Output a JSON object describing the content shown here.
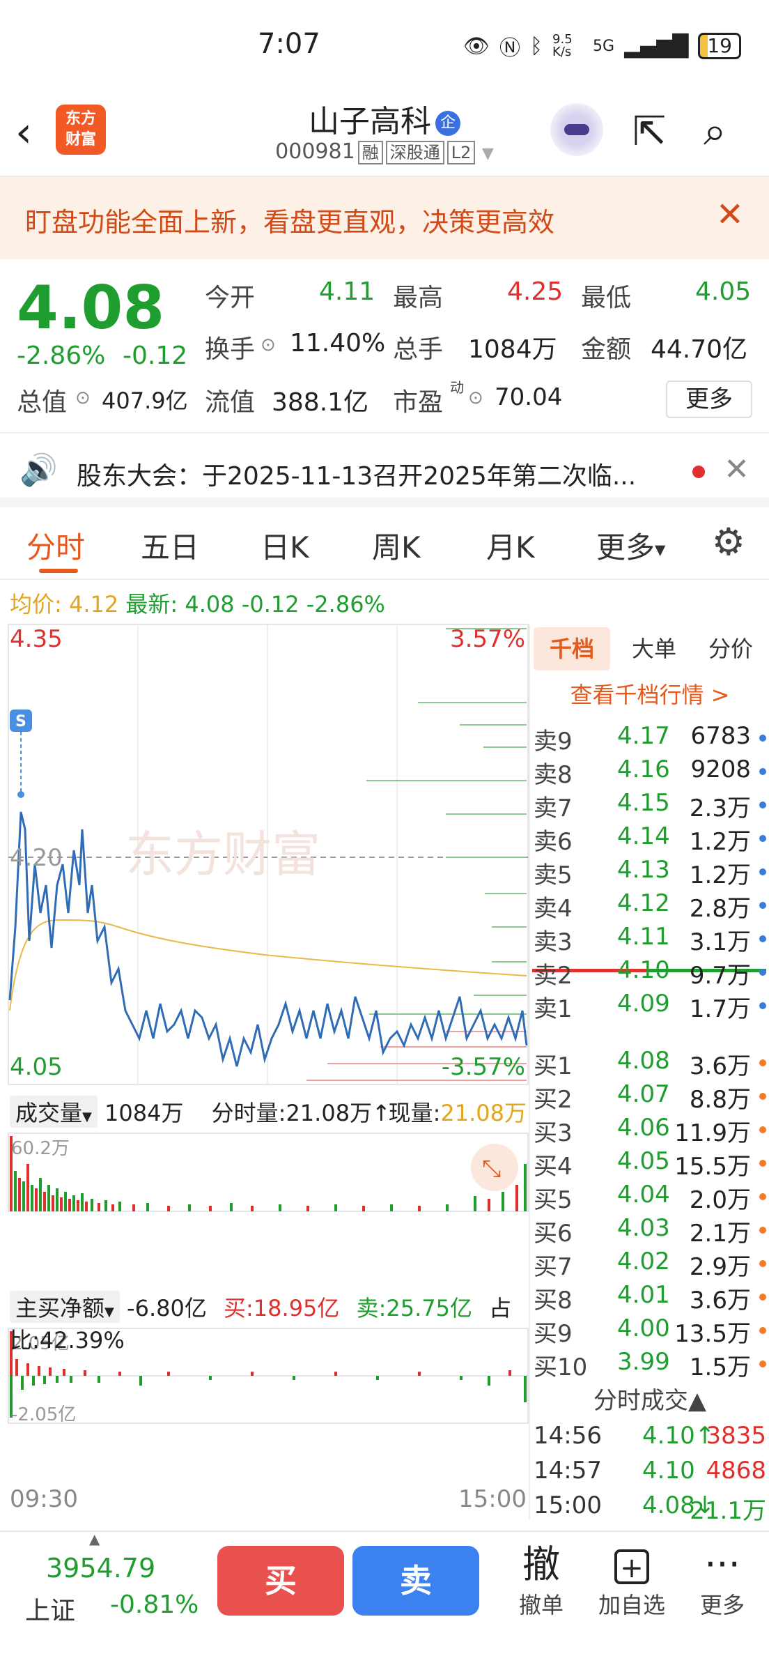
{
  "status_bar": {
    "time": "7:07",
    "net_speed": "9.5 K/s",
    "network": "5G",
    "battery": "19"
  },
  "header": {
    "logo_text": "东方财富",
    "title": "山子高科",
    "badge": "企",
    "code": "000981",
    "tags": [
      "融",
      "深股通",
      "L2"
    ]
  },
  "banner": {
    "text": "盯盘功能全面上新，看盘更直观，决策更高效"
  },
  "quote": {
    "price": "4.08",
    "change_pct": "-2.86%",
    "change": "-0.12",
    "open_label": "今开",
    "open": "4.11",
    "high_label": "最高",
    "high": "4.25",
    "low_label": "最低",
    "low": "4.05",
    "turnover_label": "换手",
    "turnover": "11.40%",
    "volume_label": "总手",
    "volume": "1084万",
    "amount_label": "金额",
    "amount": "44.70亿",
    "mktcap_label": "总值",
    "mktcap": "407.9亿",
    "float_label": "流值",
    "float": "388.1亿",
    "pe_label": "市盈",
    "pe_sup": "动",
    "pe": "70.04",
    "more": "更多"
  },
  "notice": {
    "text": "股东大会：于2025-11-13召开2025年第二次临..."
  },
  "tabs": [
    "分时",
    "五日",
    "日K",
    "周K",
    "月K",
    "更多"
  ],
  "avg_line": {
    "avg_label": "均价:",
    "avg": "4.12",
    "last_label": "最新:",
    "last": "4.08",
    "chg": "-0.12",
    "pct": "-2.86%"
  },
  "chart": {
    "price_high": "4.35",
    "price_mid": "4.20",
    "price_low": "4.05",
    "pct_high": "3.57%",
    "pct_low": "-3.57%",
    "watermark": "东方财富",
    "time_start": "09:30",
    "time_end": "15:00",
    "marker": "S"
  },
  "volume": {
    "selector": "成交量",
    "total": "1084万",
    "tick_vol": "分时量:21.08万↑",
    "now_label": "现量:",
    "now": "21.08万",
    "max": "60.2万"
  },
  "net_flow": {
    "selector": "主买净额",
    "net": "-6.80亿",
    "buy": "买:18.95亿",
    "sell": "卖:25.75亿",
    "ratio": "占比:42.39%",
    "top": "2.05亿",
    "bottom": "-2.05亿"
  },
  "right_panel": {
    "tabs": [
      "千档",
      "大单",
      "分价"
    ],
    "link": "查看千档行情 >",
    "asks": [
      {
        "label": "卖9",
        "price": "4.17",
        "vol": "6783"
      },
      {
        "label": "卖8",
        "price": "4.16",
        "vol": "9208"
      },
      {
        "label": "卖7",
        "price": "4.15",
        "vol": "2.3万"
      },
      {
        "label": "卖6",
        "price": "4.14",
        "vol": "1.2万"
      },
      {
        "label": "卖5",
        "price": "4.13",
        "vol": "1.2万"
      },
      {
        "label": "卖4",
        "price": "4.12",
        "vol": "2.8万"
      },
      {
        "label": "卖3",
        "price": "4.11",
        "vol": "3.1万"
      },
      {
        "label": "卖2",
        "price": "4.10",
        "vol": "9.7万"
      },
      {
        "label": "卖1",
        "price": "4.09",
        "vol": "1.7万"
      }
    ],
    "bids": [
      {
        "label": "买1",
        "price": "4.08",
        "vol": "3.6万"
      },
      {
        "label": "买2",
        "price": "4.07",
        "vol": "8.8万"
      },
      {
        "label": "买3",
        "price": "4.06",
        "vol": "11.9万"
      },
      {
        "label": "买4",
        "price": "4.05",
        "vol": "15.5万"
      },
      {
        "label": "买5",
        "price": "4.04",
        "vol": "2.0万"
      },
      {
        "label": "买6",
        "price": "4.03",
        "vol": "2.1万"
      },
      {
        "label": "买7",
        "price": "4.02",
        "vol": "2.9万"
      },
      {
        "label": "买8",
        "price": "4.01",
        "vol": "3.6万"
      },
      {
        "label": "买9",
        "price": "4.00",
        "vol": "13.5万"
      },
      {
        "label": "买10",
        "price": "3.99",
        "vol": "1.5万"
      }
    ],
    "ticks_title": "分时成交▲",
    "ticks": [
      {
        "time": "14:56",
        "price": "4.10↑",
        "vol": "3835",
        "vol_color": "#e0302d"
      },
      {
        "time": "14:57",
        "price": "4.10",
        "vol": "4868",
        "vol_color": "#e0302d"
      },
      {
        "time": "15:00",
        "price": "4.08↓",
        "vol": "21.1万",
        "vol_color": "#1f9e2f"
      }
    ]
  },
  "bottom_bar": {
    "index_value": "3954.79",
    "index_name": "上证",
    "index_change": "-0.81%",
    "buy": "买",
    "sell": "卖",
    "cancel_icon": "撤",
    "cancel": "撤单",
    "add_watch_icon": "+",
    "add_watch": "加自选",
    "more_icon": "···",
    "more": "更多"
  },
  "colors": {
    "up": "#e0302d",
    "down": "#1f9e2f",
    "accent": "#e55a1c",
    "price_line": "#2f6cb5",
    "avg_line": "#e8b948"
  }
}
